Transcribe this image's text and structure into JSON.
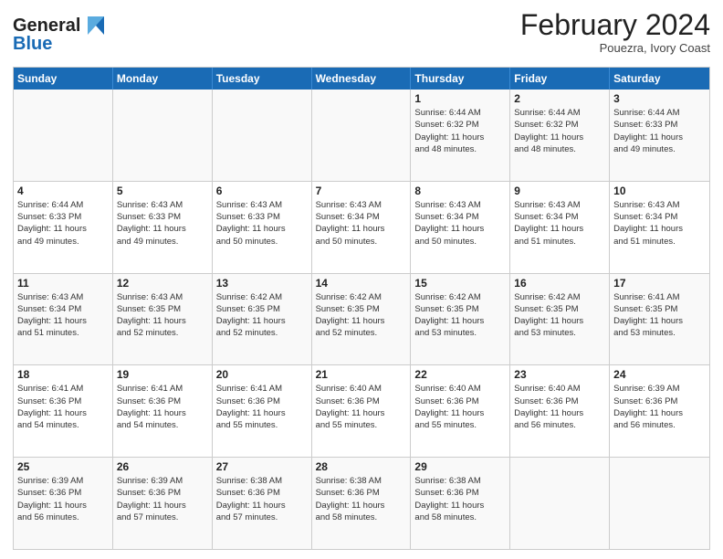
{
  "header": {
    "logo_line1": "General",
    "logo_line2": "Blue",
    "title": "February 2024",
    "subtitle": "Pouezra, Ivory Coast"
  },
  "weekdays": [
    "Sunday",
    "Monday",
    "Tuesday",
    "Wednesday",
    "Thursday",
    "Friday",
    "Saturday"
  ],
  "rows": [
    [
      {
        "day": "",
        "info": ""
      },
      {
        "day": "",
        "info": ""
      },
      {
        "day": "",
        "info": ""
      },
      {
        "day": "",
        "info": ""
      },
      {
        "day": "1",
        "info": "Sunrise: 6:44 AM\nSunset: 6:32 PM\nDaylight: 11 hours\nand 48 minutes."
      },
      {
        "day": "2",
        "info": "Sunrise: 6:44 AM\nSunset: 6:32 PM\nDaylight: 11 hours\nand 48 minutes."
      },
      {
        "day": "3",
        "info": "Sunrise: 6:44 AM\nSunset: 6:33 PM\nDaylight: 11 hours\nand 49 minutes."
      }
    ],
    [
      {
        "day": "4",
        "info": "Sunrise: 6:44 AM\nSunset: 6:33 PM\nDaylight: 11 hours\nand 49 minutes."
      },
      {
        "day": "5",
        "info": "Sunrise: 6:43 AM\nSunset: 6:33 PM\nDaylight: 11 hours\nand 49 minutes."
      },
      {
        "day": "6",
        "info": "Sunrise: 6:43 AM\nSunset: 6:33 PM\nDaylight: 11 hours\nand 50 minutes."
      },
      {
        "day": "7",
        "info": "Sunrise: 6:43 AM\nSunset: 6:34 PM\nDaylight: 11 hours\nand 50 minutes."
      },
      {
        "day": "8",
        "info": "Sunrise: 6:43 AM\nSunset: 6:34 PM\nDaylight: 11 hours\nand 50 minutes."
      },
      {
        "day": "9",
        "info": "Sunrise: 6:43 AM\nSunset: 6:34 PM\nDaylight: 11 hours\nand 51 minutes."
      },
      {
        "day": "10",
        "info": "Sunrise: 6:43 AM\nSunset: 6:34 PM\nDaylight: 11 hours\nand 51 minutes."
      }
    ],
    [
      {
        "day": "11",
        "info": "Sunrise: 6:43 AM\nSunset: 6:34 PM\nDaylight: 11 hours\nand 51 minutes."
      },
      {
        "day": "12",
        "info": "Sunrise: 6:43 AM\nSunset: 6:35 PM\nDaylight: 11 hours\nand 52 minutes."
      },
      {
        "day": "13",
        "info": "Sunrise: 6:42 AM\nSunset: 6:35 PM\nDaylight: 11 hours\nand 52 minutes."
      },
      {
        "day": "14",
        "info": "Sunrise: 6:42 AM\nSunset: 6:35 PM\nDaylight: 11 hours\nand 52 minutes."
      },
      {
        "day": "15",
        "info": "Sunrise: 6:42 AM\nSunset: 6:35 PM\nDaylight: 11 hours\nand 53 minutes."
      },
      {
        "day": "16",
        "info": "Sunrise: 6:42 AM\nSunset: 6:35 PM\nDaylight: 11 hours\nand 53 minutes."
      },
      {
        "day": "17",
        "info": "Sunrise: 6:41 AM\nSunset: 6:35 PM\nDaylight: 11 hours\nand 53 minutes."
      }
    ],
    [
      {
        "day": "18",
        "info": "Sunrise: 6:41 AM\nSunset: 6:36 PM\nDaylight: 11 hours\nand 54 minutes."
      },
      {
        "day": "19",
        "info": "Sunrise: 6:41 AM\nSunset: 6:36 PM\nDaylight: 11 hours\nand 54 minutes."
      },
      {
        "day": "20",
        "info": "Sunrise: 6:41 AM\nSunset: 6:36 PM\nDaylight: 11 hours\nand 55 minutes."
      },
      {
        "day": "21",
        "info": "Sunrise: 6:40 AM\nSunset: 6:36 PM\nDaylight: 11 hours\nand 55 minutes."
      },
      {
        "day": "22",
        "info": "Sunrise: 6:40 AM\nSunset: 6:36 PM\nDaylight: 11 hours\nand 55 minutes."
      },
      {
        "day": "23",
        "info": "Sunrise: 6:40 AM\nSunset: 6:36 PM\nDaylight: 11 hours\nand 56 minutes."
      },
      {
        "day": "24",
        "info": "Sunrise: 6:39 AM\nSunset: 6:36 PM\nDaylight: 11 hours\nand 56 minutes."
      }
    ],
    [
      {
        "day": "25",
        "info": "Sunrise: 6:39 AM\nSunset: 6:36 PM\nDaylight: 11 hours\nand 56 minutes."
      },
      {
        "day": "26",
        "info": "Sunrise: 6:39 AM\nSunset: 6:36 PM\nDaylight: 11 hours\nand 57 minutes."
      },
      {
        "day": "27",
        "info": "Sunrise: 6:38 AM\nSunset: 6:36 PM\nDaylight: 11 hours\nand 57 minutes."
      },
      {
        "day": "28",
        "info": "Sunrise: 6:38 AM\nSunset: 6:36 PM\nDaylight: 11 hours\nand 58 minutes."
      },
      {
        "day": "29",
        "info": "Sunrise: 6:38 AM\nSunset: 6:36 PM\nDaylight: 11 hours\nand 58 minutes."
      },
      {
        "day": "",
        "info": ""
      },
      {
        "day": "",
        "info": ""
      }
    ]
  ]
}
